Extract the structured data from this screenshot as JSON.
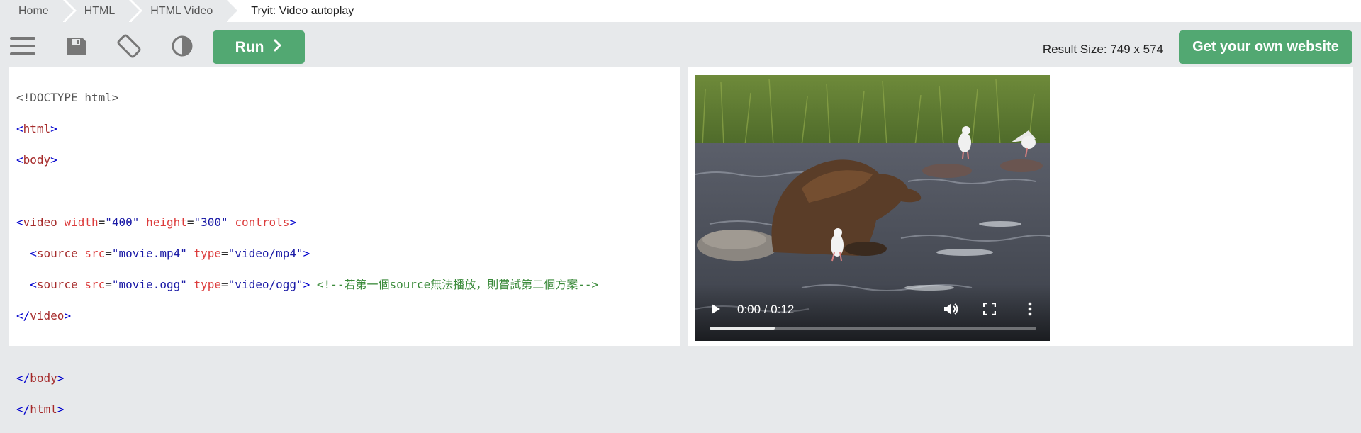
{
  "breadcrumb": {
    "items": [
      "Home",
      "HTML",
      "HTML Video"
    ],
    "current": "Tryit: Video autoplay"
  },
  "toolbar": {
    "icons": [
      "menu-icon",
      "save-icon",
      "rotate-icon",
      "contrast-icon"
    ],
    "run_label": "Run",
    "run_icon": "chevron-right-icon",
    "result_size": "Result Size: 749 x 574",
    "own_website_label": "Get your own website"
  },
  "editor": {
    "lines": {
      "l1": "<!DOCTYPE html>",
      "l2_open": "<",
      "l2_tag": "html",
      "l2_close": ">",
      "l3_open": "<",
      "l3_tag": "body",
      "l3_close": ">",
      "l5_open": "<",
      "l5_tag": "video",
      "l5_a1": "width",
      "l5_eq1": "=",
      "l5_v1": "\"400\"",
      "l5_a2": "height",
      "l5_eq2": "=",
      "l5_v2": "\"300\"",
      "l5_a3": "controls",
      "l5_close": ">",
      "l6_indent": "  ",
      "l6_open": "<",
      "l6_tag": "source",
      "l6_a1": "src",
      "l6_eq1": "=",
      "l6_v1": "\"movie.mp4\"",
      "l6_a2": "type",
      "l6_eq2": "=",
      "l6_v2": "\"video/mp4\"",
      "l6_close": ">",
      "l7_indent": "  ",
      "l7_open": "<",
      "l7_tag": "source",
      "l7_a1": "src",
      "l7_eq1": "=",
      "l7_v1": "\"movie.ogg\"",
      "l7_a2": "type",
      "l7_eq2": "=",
      "l7_v2": "\"video/ogg\"",
      "l7_close": ">",
      "l7_comment": "<!--若第一個source無法播放，則嘗試第二個方案-->",
      "l8_open": "</",
      "l8_tag": "video",
      "l8_close": ">",
      "l10_open": "</",
      "l10_tag": "body",
      "l10_close": ">",
      "l11_open": "</",
      "l11_tag": "html",
      "l11_close": ">"
    }
  },
  "video": {
    "time": "0:00 / 0:12",
    "progress_fraction": 0.2,
    "controls": [
      "play-icon",
      "volume-icon",
      "fullscreen-icon",
      "more-vert-icon"
    ]
  },
  "colors": {
    "accent_green": "#52a872",
    "toolbar_bg": "#e7e9eb",
    "tag_color": "#a52a2a",
    "attr_color": "#dc3c3c",
    "value_color": "#1a1aa6",
    "comment_color": "#3a8a3a"
  }
}
